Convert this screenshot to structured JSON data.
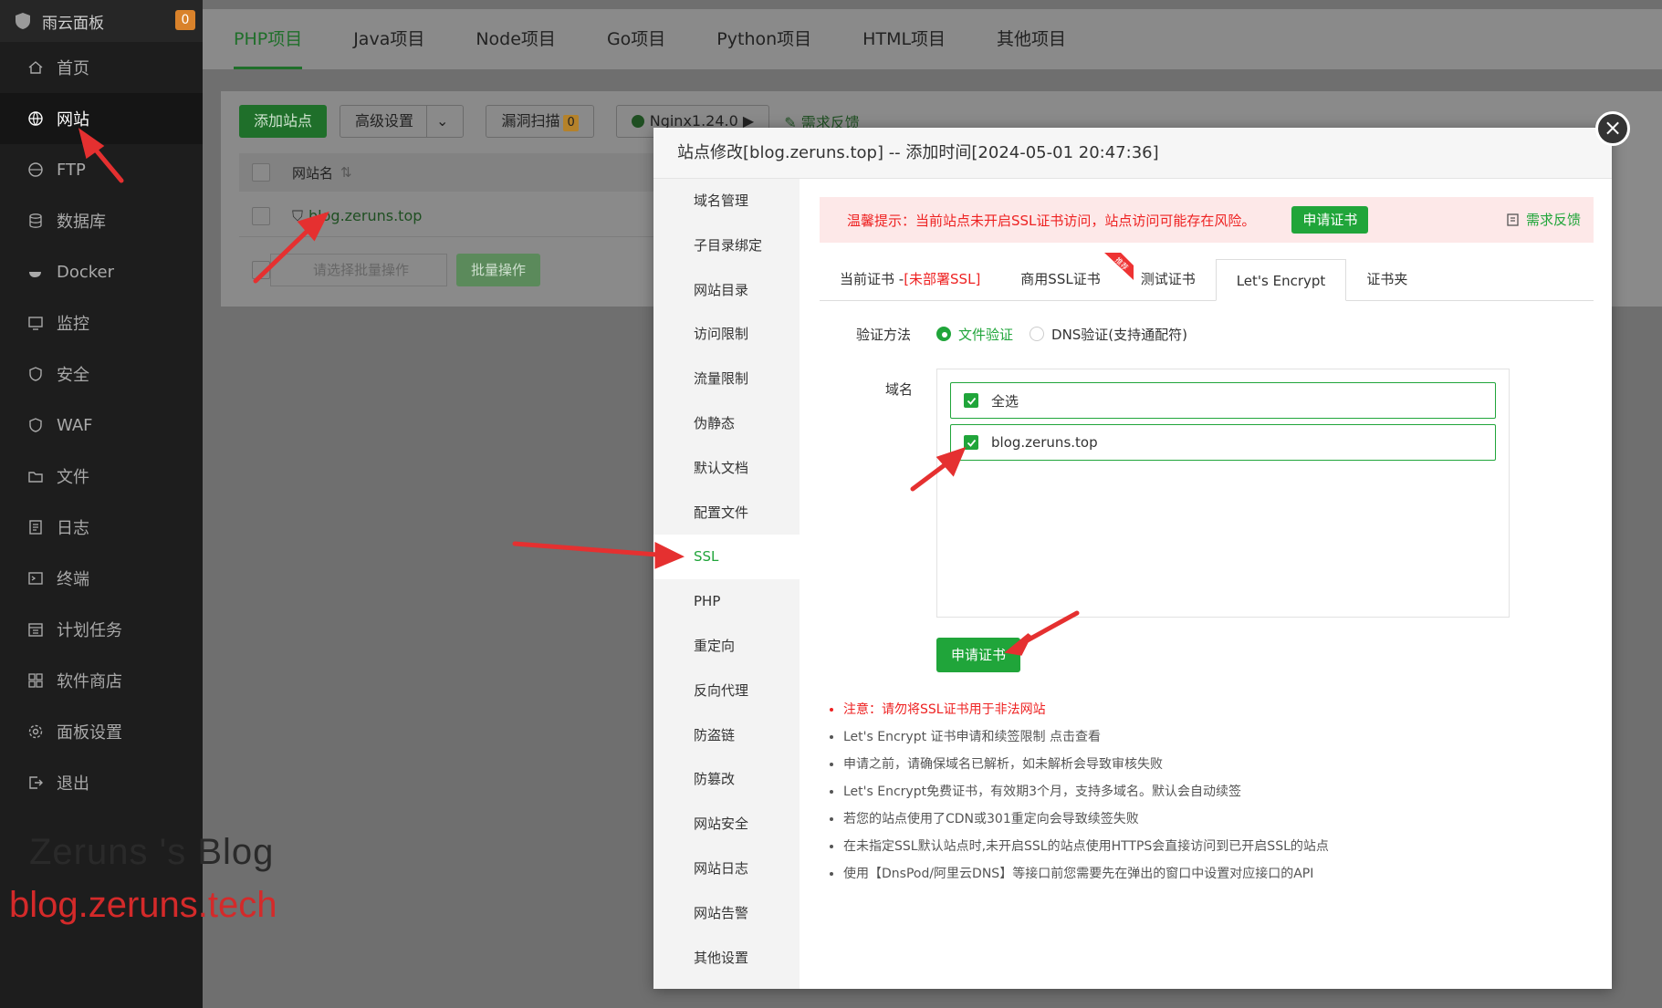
{
  "app": {
    "title": "雨云面板",
    "badge": "0"
  },
  "sidebar": {
    "items": [
      {
        "label": "首页",
        "icon": "home-icon"
      },
      {
        "label": "网站",
        "icon": "globe-icon",
        "active": true
      },
      {
        "label": "FTP",
        "icon": "ftp-icon"
      },
      {
        "label": "数据库",
        "icon": "database-icon"
      },
      {
        "label": "Docker",
        "icon": "docker-icon"
      },
      {
        "label": "监控",
        "icon": "monitor-icon"
      },
      {
        "label": "安全",
        "icon": "shield-icon"
      },
      {
        "label": "WAF",
        "icon": "waf-icon"
      },
      {
        "label": "文件",
        "icon": "folder-icon"
      },
      {
        "label": "日志",
        "icon": "log-icon"
      },
      {
        "label": "终端",
        "icon": "terminal-icon"
      },
      {
        "label": "计划任务",
        "icon": "calendar-icon"
      },
      {
        "label": "软件商店",
        "icon": "apps-icon"
      },
      {
        "label": "面板设置",
        "icon": "gear-icon"
      },
      {
        "label": "退出",
        "icon": "logout-icon"
      }
    ]
  },
  "project_tabs": [
    "PHP项目",
    "Java项目",
    "Node项目",
    "Go项目",
    "Python项目",
    "HTML项目",
    "其他项目"
  ],
  "toolbar": {
    "add_site": "添加站点",
    "advanced": "高级设置",
    "vuln_scan": "漏洞扫描",
    "vuln_count": "0",
    "nginx": "Nginx1.24.0",
    "feedback": "需求反馈"
  },
  "site_table": {
    "header_name": "网站名",
    "rows": [
      "blog.zeruns.top"
    ],
    "batch_placeholder": "请选择批量操作",
    "batch_button": "批量操作"
  },
  "modal": {
    "title": "站点修改[blog.zeruns.top] -- 添加时间[2024-05-01 20:47:36]",
    "menu": [
      "域名管理",
      "子目录绑定",
      "网站目录",
      "访问限制",
      "流量限制",
      "伪静态",
      "默认文档",
      "配置文件",
      "SSL",
      "PHP",
      "重定向",
      "反向代理",
      "防盗链",
      "防篡改",
      "网站安全",
      "网站日志",
      "网站告警",
      "其他设置"
    ],
    "active_menu": "SSL",
    "alert": {
      "text": "温馨提示：当前站点未开启SSL证书访问，站点访问可能存在风险。",
      "button": "申请证书",
      "feedback": "需求反馈"
    },
    "tabs": {
      "current_cert": "当前证书 -",
      "current_cert_status": "[未部署SSL]",
      "commercial": "商用SSL证书",
      "hot_badge": "推荐",
      "test": "测试证书",
      "letsencrypt": "Let's Encrypt",
      "folder": "证书夹"
    },
    "verify_label": "验证方法",
    "verify_options": [
      "文件验证",
      "DNS验证(支持通配符)"
    ],
    "domain_label": "域名",
    "domains": [
      "全选",
      "blog.zeruns.top"
    ],
    "apply_button": "申请证书",
    "notes": [
      "注意：请勿将SSL证书用于非法网站",
      "Let's Encrypt 证书申请和续签限制 点击查看",
      "申请之前，请确保域名已解析，如未解析会导致审核失败",
      "Let's Encrypt免费证书，有效期3个月，支持多域名。默认会自动续签",
      "若您的站点使用了CDN或301重定向会导致续签失败",
      "在未指定SSL默认站点时,未开启SSL的站点使用HTTPS会直接访问到已开启SSL的站点",
      "使用【DnsPod/阿里云DNS】等接口前您需要先在弹出的窗口中设置对应接口的API"
    ]
  },
  "watermark": {
    "line1": "Zeruns 's Blog",
    "line2": "blog.zeruns.tech"
  },
  "colors": {
    "accent": "#20a53a",
    "warning": "#e22222",
    "annotation_arrow": "#e53030"
  }
}
